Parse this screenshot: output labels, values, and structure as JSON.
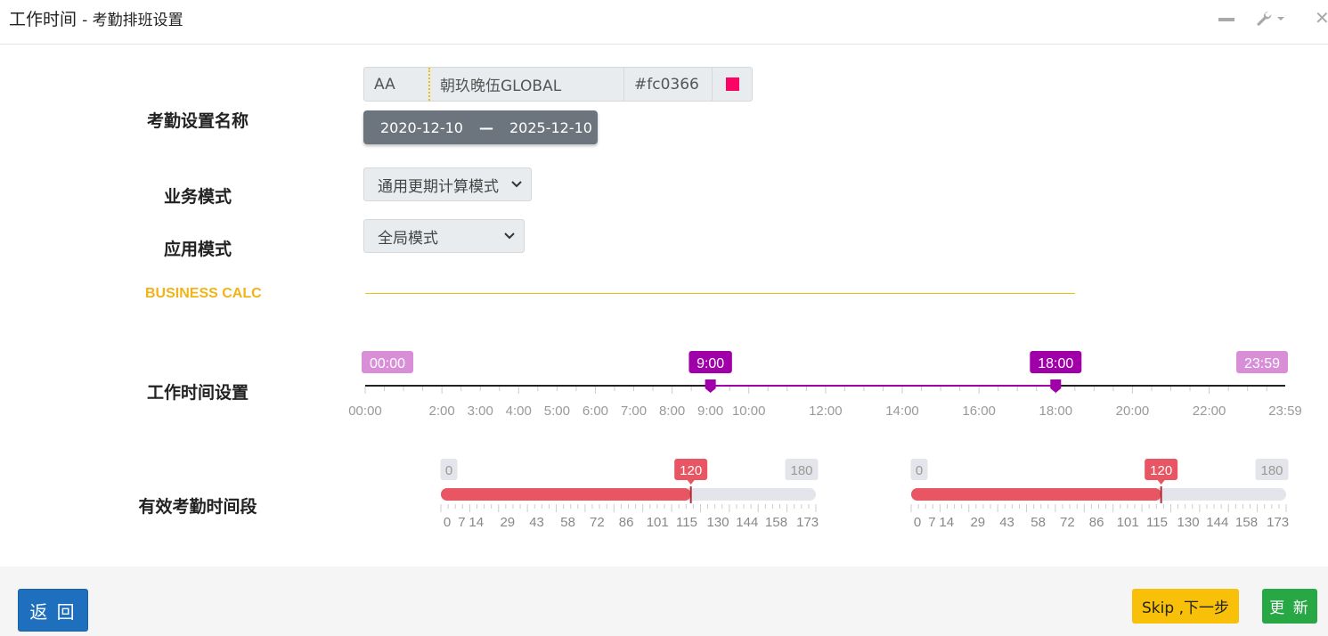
{
  "header": {
    "title": "工作时间",
    "subtitle": "- 考勤排班设置"
  },
  "labels": {
    "name": "考勤设置名称",
    "business_mode": "业务模式",
    "app_mode": "应用模式",
    "calc": "BUSINESS CALC",
    "work_time": "工作时间设置",
    "valid_period": "有效考勤时间段"
  },
  "name_group": {
    "code": "AA",
    "name": "朝玖晚伍GLOBAL",
    "color_hex": "#fc0366",
    "swatch_color": "#fc0366"
  },
  "date_range": {
    "start": "2020-12-10",
    "separator": "—",
    "end": "2025-12-10"
  },
  "business_mode": {
    "selected": "通用更期计算模式"
  },
  "app_mode": {
    "selected": "全局模式"
  },
  "time_slider": {
    "min_label": "00:00",
    "max_label": "23:59",
    "from_label": "9:00",
    "to_label": "18:00",
    "min_minutes": 0,
    "max_minutes": 1439,
    "from_minutes": 540,
    "to_minutes": 1080,
    "grid": [
      "00:00",
      "2:00",
      "3:00",
      "4:00",
      "5:00",
      "6:00",
      "7:00",
      "8:00",
      "9:00",
      "10:00",
      "12:00",
      "14:00",
      "16:00",
      "18:00",
      "20:00",
      "22:00",
      "23:59"
    ],
    "grid_minutes": [
      0,
      120,
      180,
      240,
      300,
      360,
      420,
      480,
      540,
      600,
      720,
      840,
      960,
      1080,
      1200,
      1320,
      1439
    ],
    "accent": "#a000a8",
    "edge_label_color": "#d88fd8"
  },
  "range_sliders": [
    {
      "min": 0,
      "max": 180,
      "value": 120,
      "min_label": "0",
      "max_label": "180",
      "value_label": "120",
      "grid": [
        "0",
        "7",
        "14",
        "29",
        "43",
        "58",
        "72",
        "86",
        "101",
        "115",
        "130",
        "144",
        "158",
        "173"
      ]
    },
    {
      "min": 0,
      "max": 180,
      "value": 120,
      "min_label": "0",
      "max_label": "180",
      "value_label": "120",
      "grid": [
        "0",
        "7",
        "14",
        "29",
        "43",
        "58",
        "72",
        "86",
        "101",
        "115",
        "130",
        "144",
        "158",
        "173"
      ]
    }
  ],
  "range_accent": "#e85563",
  "buttons": {
    "back": "返 回",
    "skip": "Skip ,下一步",
    "update": "更 新"
  }
}
